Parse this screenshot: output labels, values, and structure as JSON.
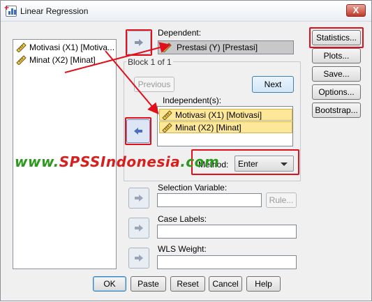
{
  "window": {
    "title": "Linear Regression",
    "close_symbol": "X"
  },
  "variables": [
    {
      "label": "Motivasi (X1) [Motiva...",
      "icon": "scale-ruler-icon"
    },
    {
      "label": "Minat (X2) [Minat]",
      "icon": "scale-ruler-icon"
    }
  ],
  "dependent": {
    "label": "Dependent:",
    "value": "Prestasi (Y) [Prestasi]"
  },
  "block": {
    "title": "Block 1 of 1",
    "previous_label": "Previous",
    "next_label": "Next",
    "independent_label": "Independent(s):",
    "independents": [
      "Motivasi (X1) [Motivasi]",
      "Minat (X2) [Minat]"
    ],
    "method_label": "Method:",
    "method_value": "Enter"
  },
  "selection": {
    "label": "Selection Variable:",
    "value": "",
    "rule_label": "Rule..."
  },
  "case_labels": {
    "label": "Case Labels:",
    "value": ""
  },
  "wls": {
    "label": "WLS Weight:",
    "value": ""
  },
  "side_buttons": {
    "statistics": "Statistics...",
    "plots": "Plots...",
    "save": "Save...",
    "options": "Options...",
    "bootstrap": "Bootstrap..."
  },
  "bottom_buttons": {
    "ok": "OK",
    "paste": "Paste",
    "reset": "Reset",
    "cancel": "Cancel",
    "help": "Help"
  },
  "watermark": {
    "prefix": "www.",
    "brand": "SPSSIndonesia",
    "suffix": ".com"
  },
  "colors": {
    "highlight_red": "#e0101a",
    "selected_yellow": "#fde89a",
    "accent_blue": "#3b6fc0"
  }
}
